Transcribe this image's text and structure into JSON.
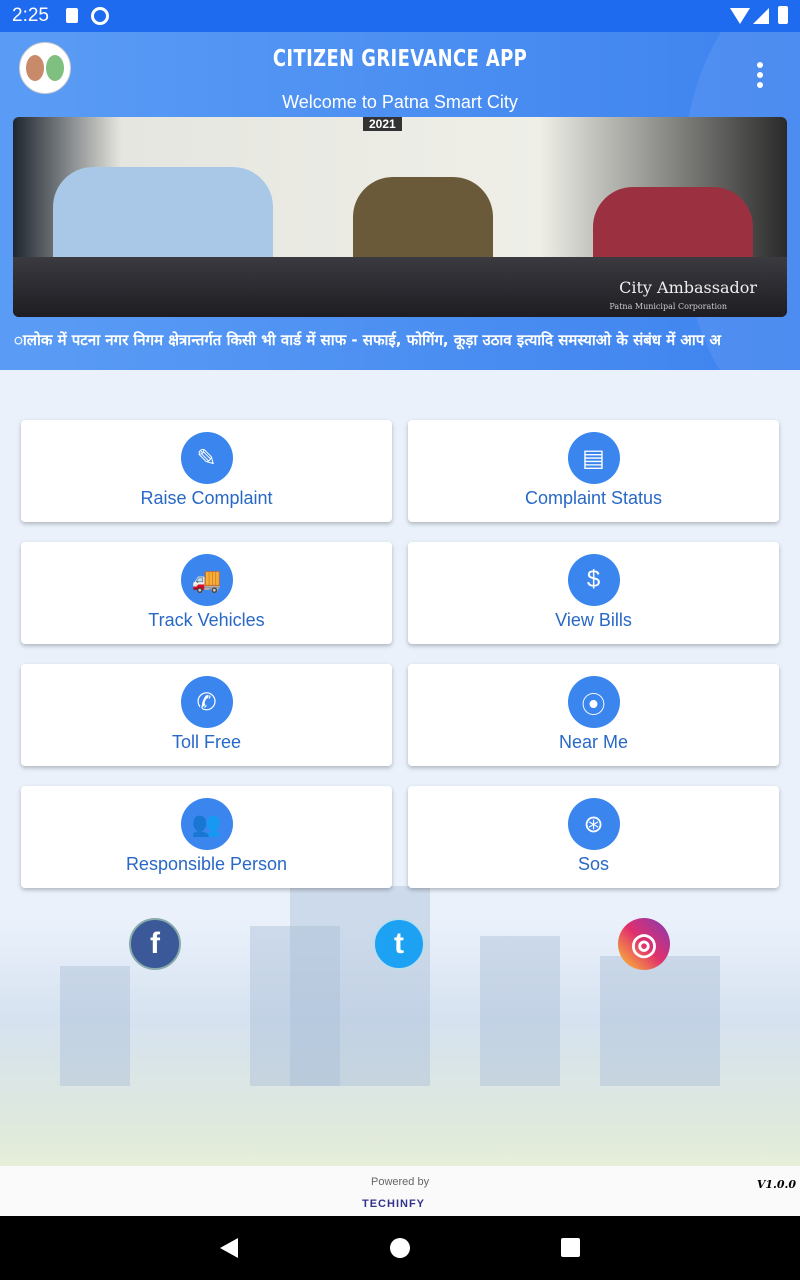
{
  "status_bar": {
    "time": "2:25",
    "icons": [
      "sd-card-icon",
      "sync-icon",
      "wifi-icon",
      "signal-icon",
      "battery-icon"
    ]
  },
  "header": {
    "title": "CITIZEN GRIEVANCE APP",
    "subtitle": "Welcome to Patna Smart City",
    "menu_icon": "more-vert-icon"
  },
  "banner": {
    "year": "2021",
    "caption": "City Ambassador",
    "sub_caption": "Patna Municipal Corporation"
  },
  "ticker": "ालोक में पटना नगर निगम क्षेत्रान्तर्गत किसी भी वार्ड में साफ - सफाई, फोगिंग, कूड़ा उठाव इत्यादि समस्याओ के संबंध में आप अ",
  "menu": [
    {
      "label": "Raise Complaint",
      "icon": "complaint-pen-icon",
      "glyph": "✎"
    },
    {
      "label": "Complaint Status",
      "icon": "document-icon",
      "glyph": "▤"
    },
    {
      "label": "Track Vehicles",
      "icon": "truck-icon",
      "glyph": "🚚"
    },
    {
      "label": "View Bills",
      "icon": "bill-dollar-icon",
      "glyph": "$"
    },
    {
      "label": "Toll Free",
      "icon": "phone-icon",
      "glyph": "✆"
    },
    {
      "label": "Near Me",
      "icon": "location-pin-icon",
      "glyph": "⦿"
    },
    {
      "label": "Responsible Person",
      "icon": "group-icon",
      "glyph": "👥"
    },
    {
      "label": "Sos",
      "icon": "lifebuoy-icon",
      "glyph": "⊛"
    }
  ],
  "social": [
    {
      "name": "facebook",
      "glyph": "f",
      "color": "#3b5998"
    },
    {
      "name": "twitter",
      "glyph": "t",
      "color": "#1da1f2"
    },
    {
      "name": "instagram",
      "glyph": "◎",
      "color": "#d6249f"
    }
  ],
  "footer": {
    "powered_by": "Powered by",
    "brand": "TECHINFY",
    "version": "V1.0.0"
  },
  "colors": {
    "status_bar": "#1f6bf0",
    "header": "#4a8ef2",
    "accent": "#3a86ee",
    "label": "#2868c6"
  }
}
